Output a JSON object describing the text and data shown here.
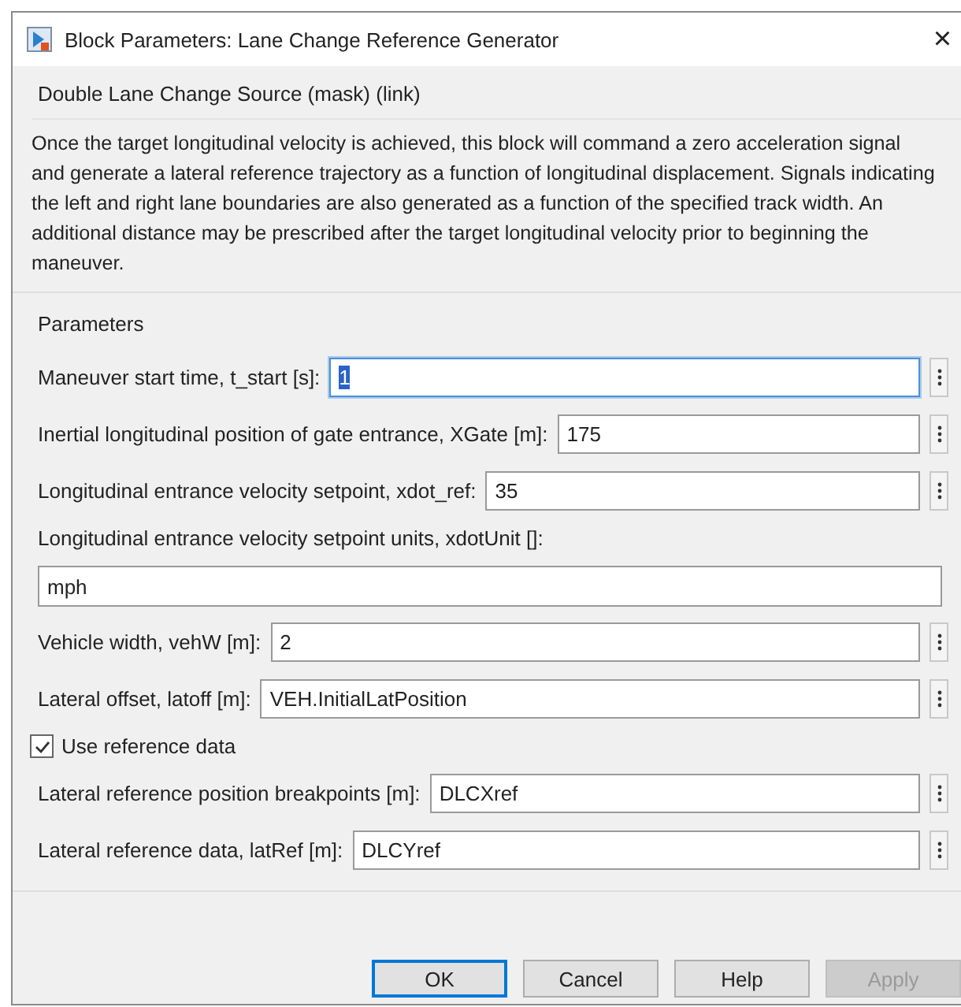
{
  "window": {
    "title": "Block Parameters: Lane Change Reference Generator",
    "close": "×"
  },
  "block": {
    "name": "Double Lane Change Source (mask) (link)",
    "description": "Once the target longitudinal velocity is achieved, this block will command a zero acceleration signal and generate a lateral reference trajectory as a function of longitudinal displacement. Signals indicating the left and right lane boundaries are also generated as a function of the specified track width. An additional distance may be prescribed after the target longitudinal velocity prior to beginning the maneuver."
  },
  "parameters": {
    "title": "Parameters",
    "items": [
      {
        "kind": "inline",
        "label": "Maneuver start time, t_start [s]:",
        "value": "1",
        "focused": true
      },
      {
        "kind": "inline",
        "label": "Inertial longitudinal position of gate entrance, XGate [m]:",
        "value": "175",
        "focused": false
      },
      {
        "kind": "inline",
        "label": "Longitudinal entrance velocity setpoint, xdot_ref:",
        "value": "35",
        "focused": false
      },
      {
        "kind": "stacked",
        "label": "Longitudinal entrance velocity setpoint units, xdotUnit []:",
        "value": "mph",
        "focused": false
      },
      {
        "kind": "inline",
        "label": "Vehicle width, vehW [m]:",
        "value": "2",
        "focused": false
      },
      {
        "kind": "inline",
        "label": "Lateral offset, latoff [m]:",
        "value": "VEH.InitialLatPosition",
        "focused": false
      },
      {
        "kind": "checkbox",
        "label": "Use reference data",
        "checked": true
      },
      {
        "kind": "inline",
        "label": "Lateral reference position breakpoints [m]:",
        "value": "DLCXref",
        "focused": false
      },
      {
        "kind": "inline",
        "label": "Lateral reference data, latRef [m]:",
        "value": "DLCYref",
        "focused": false
      }
    ]
  },
  "buttons": [
    {
      "label": "OK",
      "default": true,
      "disabled": false
    },
    {
      "label": "Cancel",
      "default": false,
      "disabled": false
    },
    {
      "label": "Help",
      "default": false,
      "disabled": false
    },
    {
      "label": "Apply",
      "default": false,
      "disabled": true
    }
  ]
}
